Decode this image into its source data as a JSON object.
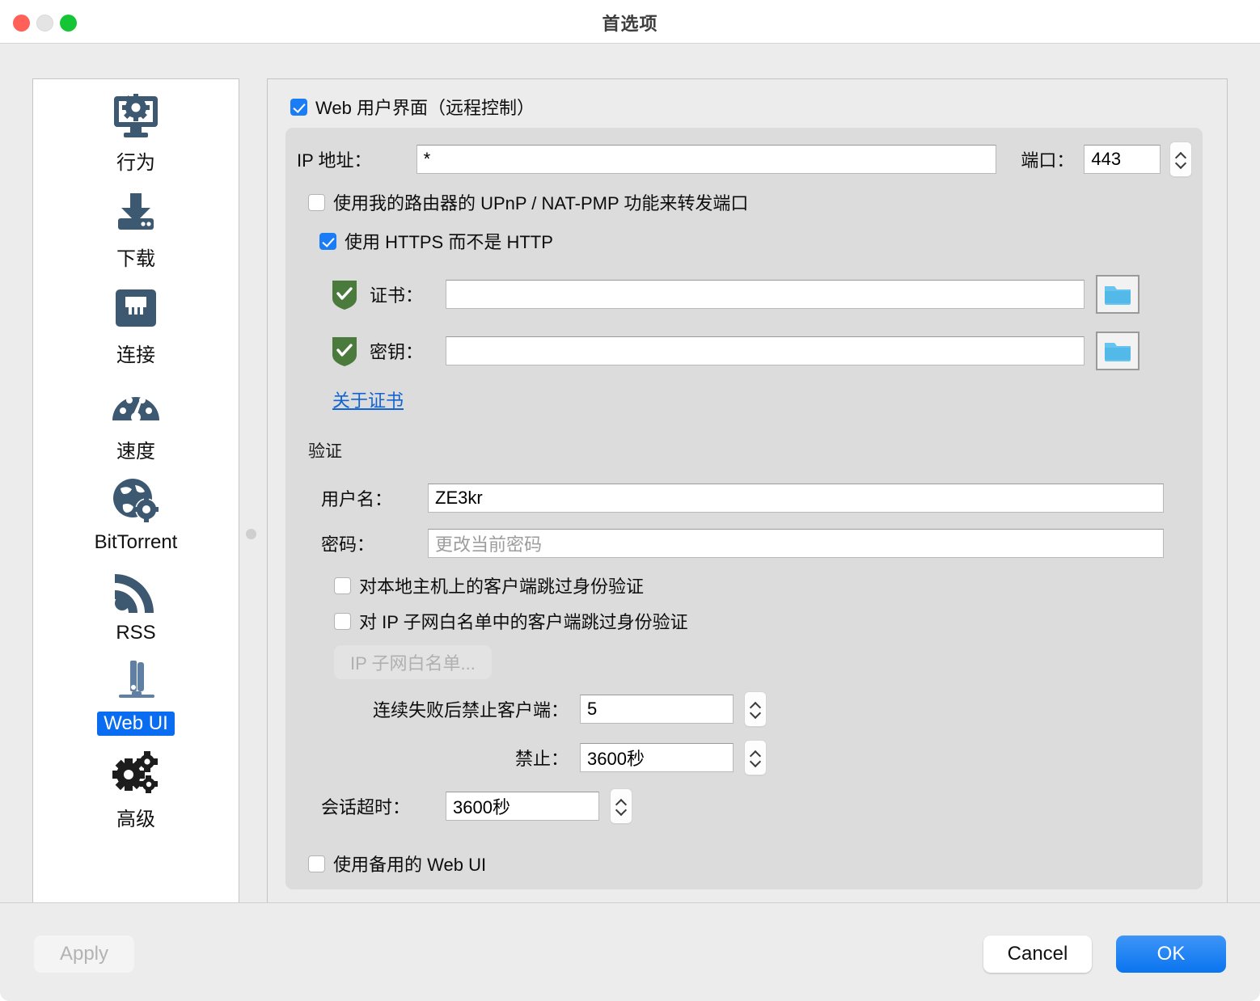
{
  "window": {
    "title": "首选项",
    "traffic_lights": [
      "close-button",
      "minimize-button",
      "maximize-button"
    ]
  },
  "sidebar": {
    "items": [
      {
        "label": "行为",
        "icon": "monitor-gear-icon",
        "active": false
      },
      {
        "label": "下载",
        "icon": "download-icon",
        "active": false
      },
      {
        "label": "连接",
        "icon": "ethernet-port-icon",
        "active": false
      },
      {
        "label": "速度",
        "icon": "speedometer-icon",
        "active": false
      },
      {
        "label": "BitTorrent",
        "icon": "globe-gear-icon",
        "active": false
      },
      {
        "label": "RSS",
        "icon": "rss-icon",
        "active": false
      },
      {
        "label": "Web UI",
        "icon": "server-tower-icon",
        "active": true
      },
      {
        "label": "高级",
        "icon": "gears-icon",
        "active": false
      }
    ]
  },
  "main": {
    "web_ui_enable": {
      "label": "Web 用户界面（远程控制）",
      "checked": true
    },
    "ip_address": {
      "label": "IP 地址：",
      "value": "*"
    },
    "port": {
      "label": "端口：",
      "value": "443"
    },
    "upnp": {
      "label": "使用我的路由器的 UPnP / NAT-PMP 功能来转发端口",
      "checked": false
    },
    "https": {
      "label": "使用 HTTPS 而不是 HTTP",
      "checked": true
    },
    "certificate": {
      "label": "证书：",
      "value": "",
      "icon": "green-shield-icon",
      "browse_icon": "folder-icon"
    },
    "key": {
      "label": "密钥：",
      "value": "",
      "icon": "green-shield-icon",
      "browse_icon": "folder-icon"
    },
    "about_certificate_link": "关于证书",
    "auth": {
      "caption": "验证",
      "username": {
        "label": "用户名：",
        "value": "ZE3kr"
      },
      "password": {
        "label": "密码：",
        "value": "",
        "placeholder": "更改当前密码"
      },
      "bypass_localhost": {
        "label": "对本地主机上的客户端跳过身份验证",
        "checked": false
      },
      "bypass_whitelist": {
        "label": "对 IP 子网白名单中的客户端跳过身份验证",
        "checked": false
      },
      "whitelist_button": {
        "label": "IP 子网白名单...",
        "enabled": false
      },
      "ban_after": {
        "label": "连续失败后禁止客户端：",
        "value": "5"
      },
      "ban_duration": {
        "label": "禁止：",
        "value": "3600秒"
      },
      "session_timeout": {
        "label": "会话超时：",
        "value": "3600秒"
      }
    },
    "alt_webui": {
      "label": "使用备用的 Web UI",
      "checked": false
    }
  },
  "footer": {
    "apply": {
      "label": "Apply",
      "enabled": false
    },
    "cancel": {
      "label": "Cancel",
      "enabled": true
    },
    "ok": {
      "label": "OK",
      "enabled": true
    }
  },
  "colors": {
    "accent": "#0a74ef",
    "selection": "#0a6cf0",
    "icon": "#3d5871",
    "link": "#1263d2",
    "shield": "#4a7a3c"
  }
}
